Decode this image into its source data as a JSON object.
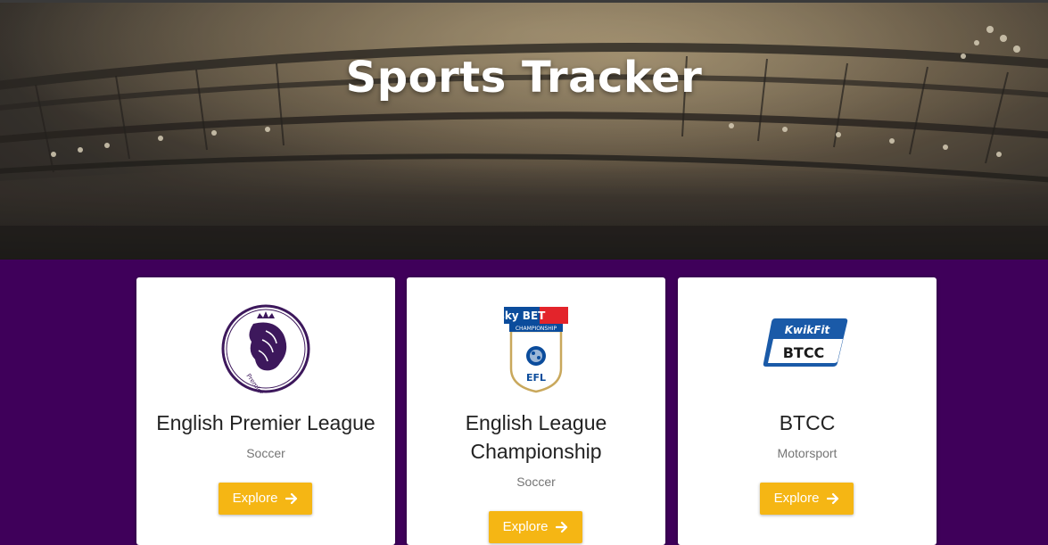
{
  "hero": {
    "title": "Sports Tracker"
  },
  "leagues": [
    {
      "name": "English Premier League",
      "sport": "Soccer",
      "button_label": "Explore",
      "logo": "premier-league-lion-logo",
      "logo_text": "Premier League"
    },
    {
      "name": "English League Championship",
      "sport": "Soccer",
      "button_label": "Explore",
      "logo": "skybet-efl-championship-logo",
      "logo_text_top": "sky BET",
      "logo_text_mid": "CHAMPIONSHIP",
      "logo_text_bottom": "EFL"
    },
    {
      "name": "BTCC",
      "sport": "Motorsport",
      "button_label": "Explore",
      "logo": "kwikfit-btcc-logo",
      "logo_text_top": "KwikFit",
      "logo_text_bottom": "BTCC"
    }
  ],
  "colors": {
    "background": "#3f005a",
    "button": "#f5b614",
    "premier_league_purple": "#3d185c",
    "skybet_blue": "#0b4c9c",
    "skybet_red": "#e3242b",
    "efl_gold": "#c9a85c",
    "kwikfit_blue": "#1a5aa8"
  }
}
